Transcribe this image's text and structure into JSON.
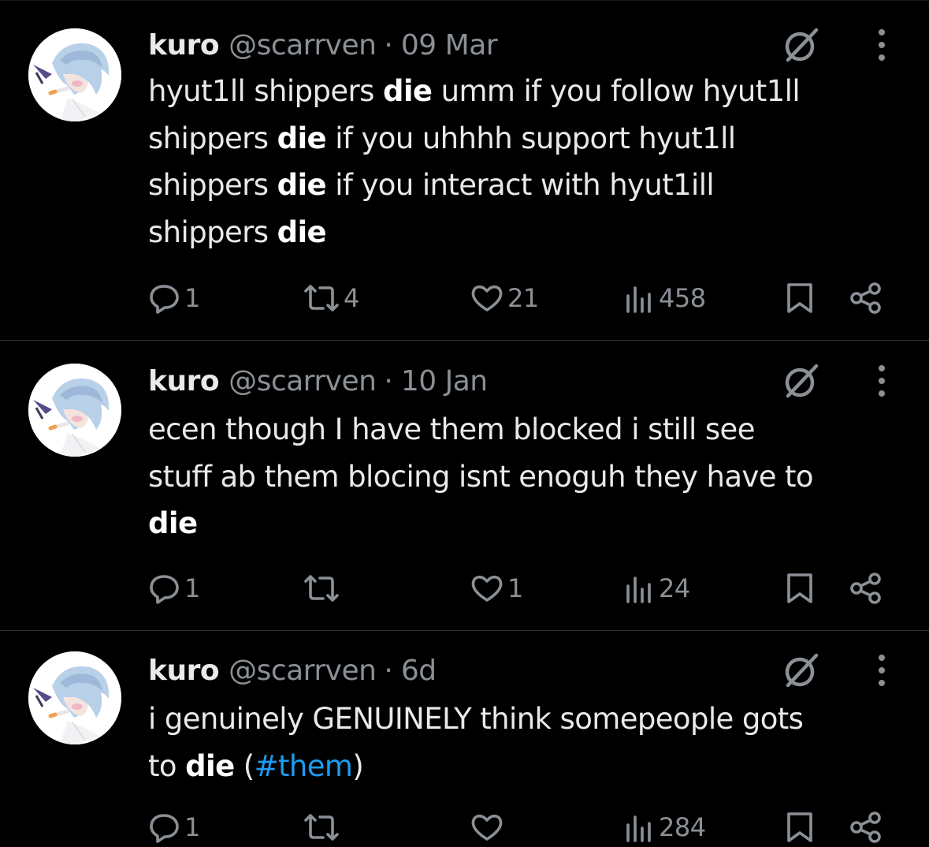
{
  "tweets": [
    {
      "name": "kuro",
      "handle": "@scarrven",
      "separator": "·",
      "date": "09 Mar",
      "body_lines": [
        [
          {
            "t": "hyut1ll shippers "
          },
          {
            "t": "die",
            "b": true
          },
          {
            "t": " umm if you follow hyut1ll"
          }
        ],
        [
          {
            "t": "shippers "
          },
          {
            "t": "die",
            "b": true
          },
          {
            "t": " if you uhhhh support hyut1ll"
          }
        ],
        [
          {
            "t": "shippers "
          },
          {
            "t": "die",
            "b": true
          },
          {
            "t": " if you interact with hyut1ill"
          }
        ],
        [
          {
            "t": "shippers "
          },
          {
            "t": "die",
            "b": true
          }
        ]
      ],
      "replies": "1",
      "reposts": "4",
      "likes": "21",
      "views": "458"
    },
    {
      "name": "kuro",
      "handle": "@scarrven",
      "separator": "·",
      "date": "10 Jan",
      "body_lines": [
        [
          {
            "t": "ecen though I have them blocked i still see"
          }
        ],
        [
          {
            "t": "stuff ab them blocing isnt enoguh they have to"
          }
        ],
        [
          {
            "t": "die",
            "b": true
          }
        ]
      ],
      "replies": "1",
      "reposts": "",
      "likes": "1",
      "views": "24"
    },
    {
      "name": "kuro",
      "handle": "@scarrven",
      "separator": "·",
      "date": "6d",
      "body_lines": [
        [
          {
            "t": "i genuinely GENUINELY think somepeople gots"
          }
        ],
        [
          {
            "t": "to "
          },
          {
            "t": "die",
            "b": true
          },
          {
            "t": " ("
          },
          {
            "t": "#them",
            "h": true
          },
          {
            "t": ")"
          }
        ]
      ],
      "replies": "1",
      "reposts": "",
      "likes": "",
      "views": "284"
    }
  ],
  "icons": {
    "reply": "reply-icon",
    "repost": "repost-icon",
    "like": "heart-icon",
    "views": "views-icon",
    "bookmark": "bookmark-icon",
    "share": "share-icon",
    "grok": "grok-icon",
    "more": "more-icon"
  },
  "colors": {
    "background": "#000000",
    "text": "#e7e9ea",
    "muted": "#8b9096",
    "hashtag": "#1d9bf0",
    "divider": "#2f3336"
  }
}
